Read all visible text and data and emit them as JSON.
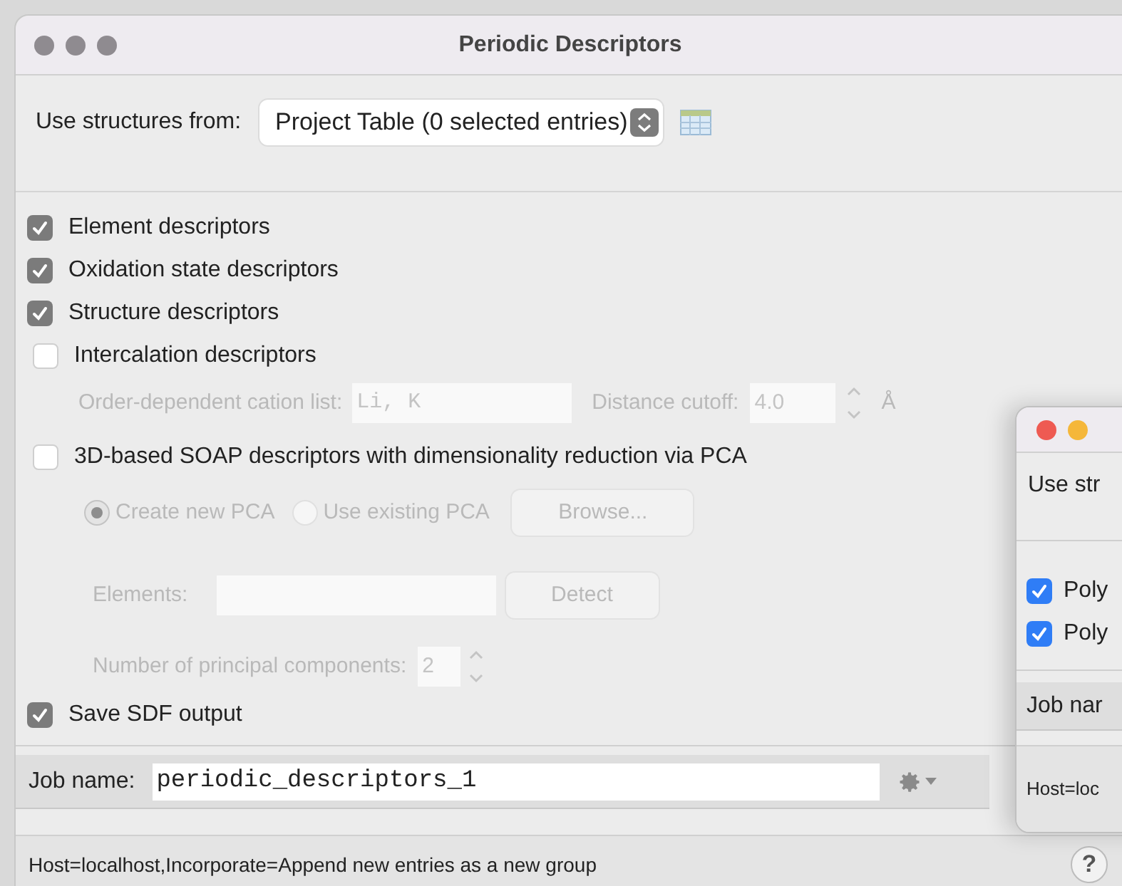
{
  "window": {
    "title": "Periodic Descriptors"
  },
  "source": {
    "label": "Use structures from:",
    "value": "Project Table (0 selected entries)"
  },
  "descriptors": [
    {
      "label": "Element descriptors",
      "checked": true
    },
    {
      "label": "Oxidation state descriptors",
      "checked": true
    },
    {
      "label": "Structure descriptors",
      "checked": true
    }
  ],
  "intercalation": {
    "label": "Intercalation descriptors",
    "checked": false,
    "cation_label": "Order-dependent cation list:",
    "cation_value": "Li, K",
    "cutoff_label": "Distance cutoff:",
    "cutoff_value": "4.0",
    "unit": "Å"
  },
  "soap": {
    "label": "3D-based SOAP descriptors with dimensionality reduction via PCA",
    "checked": false,
    "radios": [
      {
        "label": "Create new PCA",
        "selected": true
      },
      {
        "label": "Use existing PCA",
        "selected": false
      }
    ],
    "browse": "Browse...",
    "elements_label": "Elements:",
    "detect": "Detect",
    "components_label": "Number of principal components:",
    "components_value": "2"
  },
  "save_sdf": {
    "label": "Save SDF output",
    "checked": true
  },
  "job": {
    "label": "Job name:",
    "value": "periodic_descriptors_1"
  },
  "status_bar": "Host=localhost,Incorporate=Append new entries as a new group",
  "help": "?",
  "second_window": {
    "source_label": "Use str",
    "options": [
      {
        "label": "Poly",
        "checked": true
      },
      {
        "label": "Poly",
        "checked": true
      }
    ],
    "job_label": "Job nar",
    "status_bar": "Host=loc"
  }
}
